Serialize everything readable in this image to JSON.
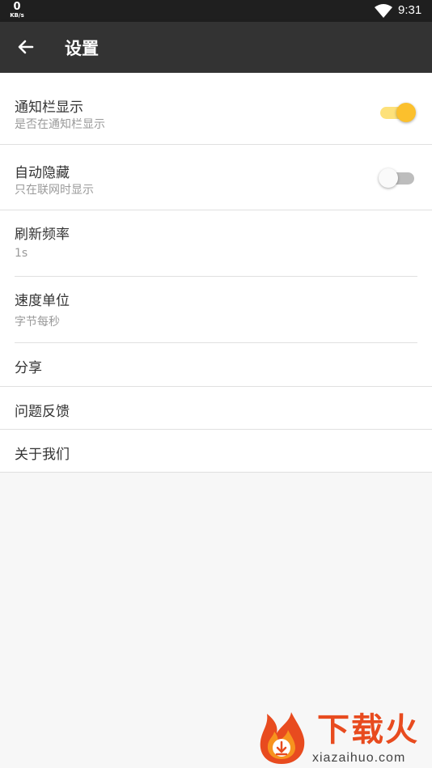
{
  "status_bar": {
    "net_speed_value": "0",
    "net_speed_unit": "KB/s",
    "time": "9:31"
  },
  "app_bar": {
    "back_icon": "arrow-left-icon",
    "title": "设置"
  },
  "settings": [
    {
      "title": "通知栏显示",
      "subtitle": "是否在通知栏显示",
      "toggle": true
    },
    {
      "title": "自动隐藏",
      "subtitle": "只在联网时显示",
      "toggle": false
    },
    {
      "title": "刷新频率",
      "subtitle": "1s"
    },
    {
      "title": "速度单位",
      "subtitle": "字节每秒"
    },
    {
      "title": "分享"
    },
    {
      "title": "问题反馈"
    },
    {
      "title": "关于我们"
    }
  ],
  "colors": {
    "accent": "#fbc02d",
    "accent_track": "#fde17a",
    "switch_off_thumb": "#fafafa",
    "switch_off_track": "#bdbdbd",
    "app_bar": "#333333"
  },
  "watermark": {
    "brand": "下载火",
    "url": "xiazaihuo.com"
  }
}
